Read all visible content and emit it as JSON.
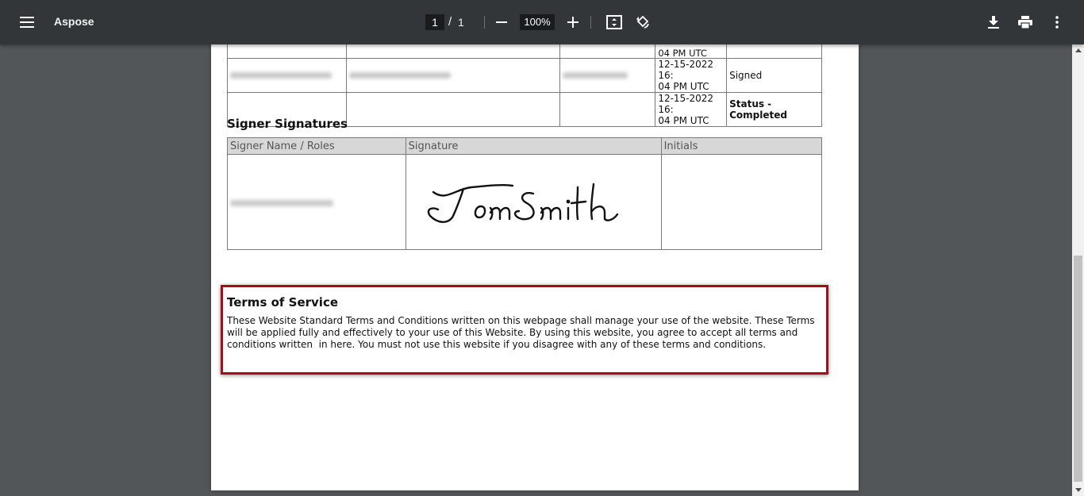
{
  "toolbar": {
    "title": "Aspose",
    "page_current": "1",
    "page_separator": "/",
    "page_total": "1",
    "zoom": "100%"
  },
  "history_rows": [
    {
      "timestamp": "12-15-2022 16:\n04 PM UTC",
      "event": "Signed"
    },
    {
      "timestamp": "12-15-2022 16:\n04 PM UTC",
      "event": "Status - Completed"
    }
  ],
  "history_partial_text": "04 PM UTC",
  "signer_section": {
    "heading": "Signer Signatures",
    "columns": [
      "Signer Name / Roles",
      "Signature",
      "Initials"
    ],
    "signature_text": "Tom Smith"
  },
  "terms": {
    "heading": "Terms of Service",
    "body": "These Website Standard Terms and Conditions written on this webpage shall manage your use of the website. These Terms will be applied fully and effectively to your use of this Website. By using this website, you agree to accept all terms and conditions written  in here. You must not use this website if you disagree with any of these terms and conditions."
  },
  "colors": {
    "toolbar_bg": "#323639",
    "viewer_bg": "#525659",
    "highlight": "#a80c1c"
  }
}
